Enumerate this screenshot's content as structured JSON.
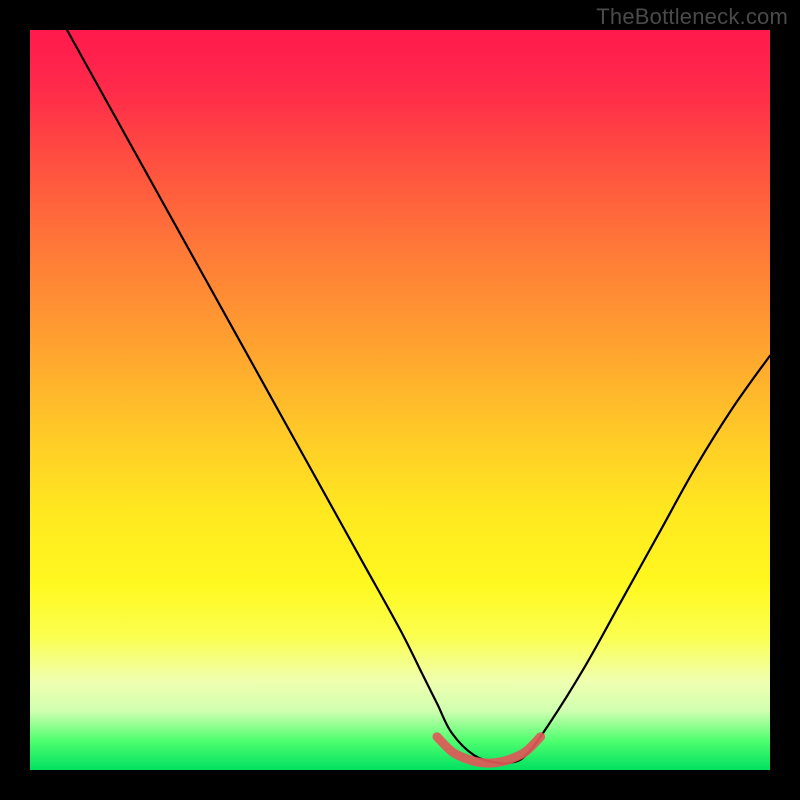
{
  "watermark": "TheBottleneck.com",
  "chart_data": {
    "type": "line",
    "title": "",
    "xlabel": "",
    "ylabel": "",
    "xlim": [
      0,
      100
    ],
    "ylim": [
      0,
      100
    ],
    "grid": false,
    "series": [
      {
        "name": "bottleneck-curve",
        "color": "#000000",
        "x": [
          5,
          10,
          15,
          20,
          25,
          30,
          35,
          40,
          45,
          50,
          53,
          55,
          57,
          60,
          63,
          65,
          67,
          70,
          75,
          80,
          85,
          90,
          95,
          100
        ],
        "y": [
          100,
          91,
          82,
          73,
          64,
          55,
          46,
          37,
          28,
          19,
          13,
          9,
          5,
          2,
          1,
          1,
          2,
          6,
          14,
          23,
          32,
          41,
          49,
          56
        ]
      },
      {
        "name": "optimal-band",
        "color": "#e86060",
        "x": [
          55,
          57,
          59,
          61,
          63,
          65,
          67,
          69
        ],
        "y": [
          4.5,
          2.5,
          1.5,
          1.0,
          1.0,
          1.5,
          2.5,
          4.5
        ]
      }
    ],
    "background": {
      "type": "vertical-gradient",
      "stops": [
        {
          "pos": 0.0,
          "color": "#ff1a4d"
        },
        {
          "pos": 0.5,
          "color": "#ffc828"
        },
        {
          "pos": 0.8,
          "color": "#fbff50"
        },
        {
          "pos": 1.0,
          "color": "#00e060"
        }
      ]
    }
  }
}
